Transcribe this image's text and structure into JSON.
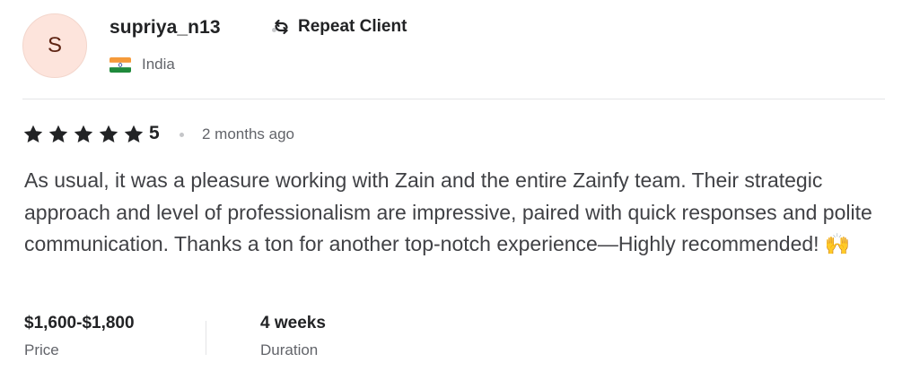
{
  "reviewer": {
    "avatar_initial": "S",
    "username": "supriya_n13",
    "badge": "Repeat Client",
    "country": "India",
    "badge_icon": "repeat-icon",
    "flag_icon": "india-flag-icon",
    "avatar_bg_color": "#fde4dc",
    "avatar_text_color": "#5e2413"
  },
  "review": {
    "stars": 5,
    "rating": "5",
    "time_ago": "2 months ago",
    "text": "As usual, it was a pleasure working with Zain and the entire Zainfy team. Their strategic approach and level of professionalism are impressive, paired with quick responses and polite communication. Thanks a ton for another top-notch experience—Highly recommended! 🙌"
  },
  "details": {
    "price_value": "$1,600-$1,800",
    "price_label": "Price",
    "duration_value": "4 weeks",
    "duration_label": "Duration"
  }
}
